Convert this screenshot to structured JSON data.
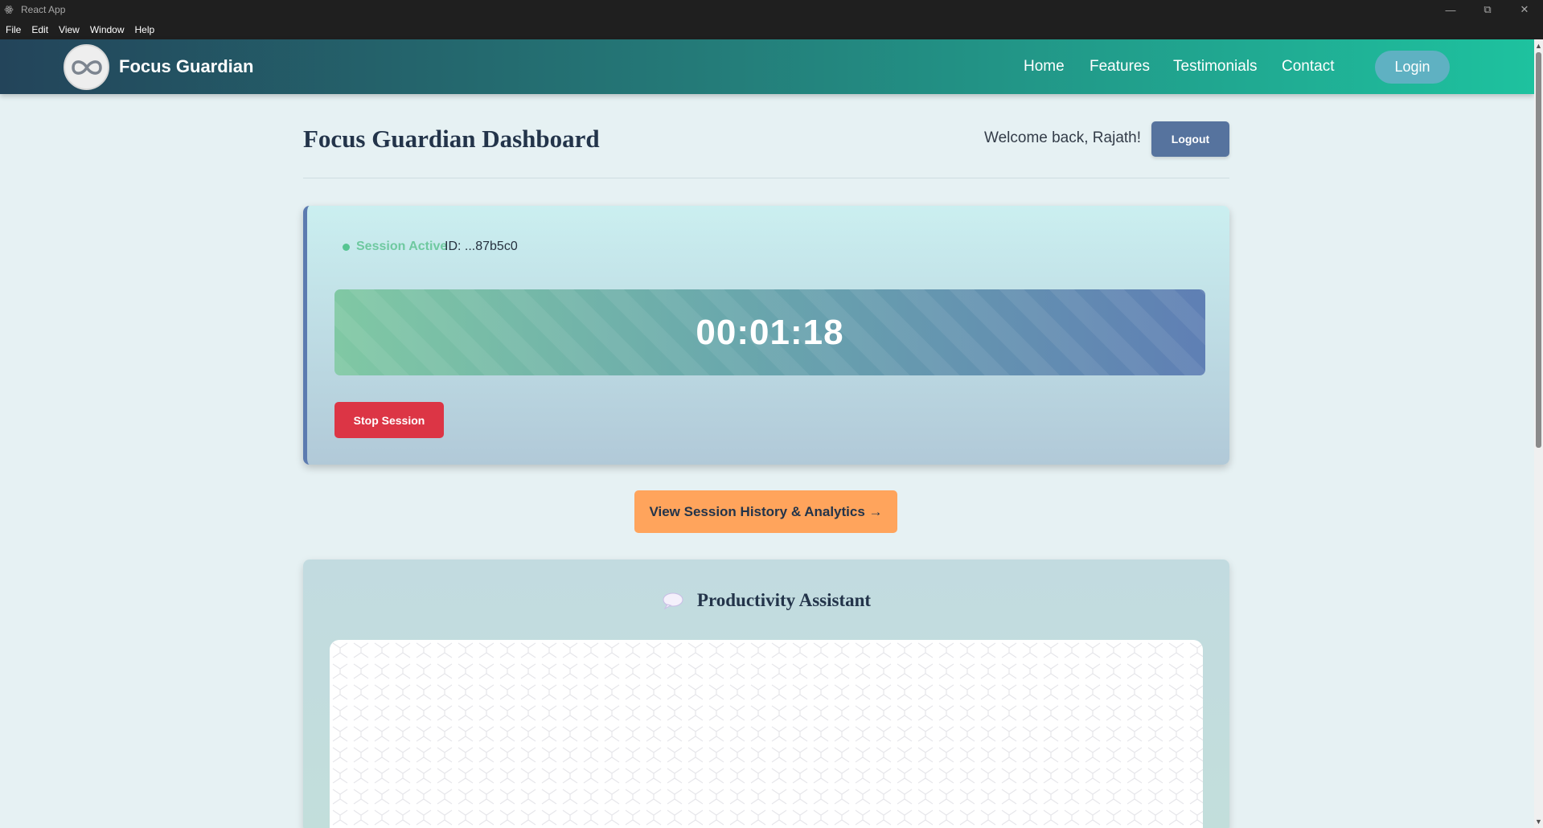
{
  "window": {
    "title": "React App",
    "controls": [
      "minimize-icon",
      "restore-icon",
      "close-icon"
    ]
  },
  "menu": [
    "File",
    "Edit",
    "View",
    "Window",
    "Help"
  ],
  "navbar": {
    "brand": "Focus Guardian",
    "links": [
      "Home",
      "Features",
      "Testimonials",
      "Contact"
    ],
    "login_label": "Login"
  },
  "header": {
    "title": "Focus Guardian Dashboard",
    "welcome": "Welcome back, Rajath!",
    "logout_label": "Logout"
  },
  "session": {
    "status": "Session Active",
    "id": "ID: ...87b5c0",
    "timer": "00:01:18",
    "stop_label": "Stop Session"
  },
  "history_button": "View Session History & Analytics →",
  "assistant": {
    "title": "Productivity Assistant",
    "icon": "chat-bubble-icon"
  },
  "colors": {
    "accent_teal": "#1ec29f",
    "nav_dark": "#23445a",
    "logout": "#56739e",
    "stop": "#dc3545",
    "history": "#ffa45c",
    "status_green": "#56c592"
  }
}
